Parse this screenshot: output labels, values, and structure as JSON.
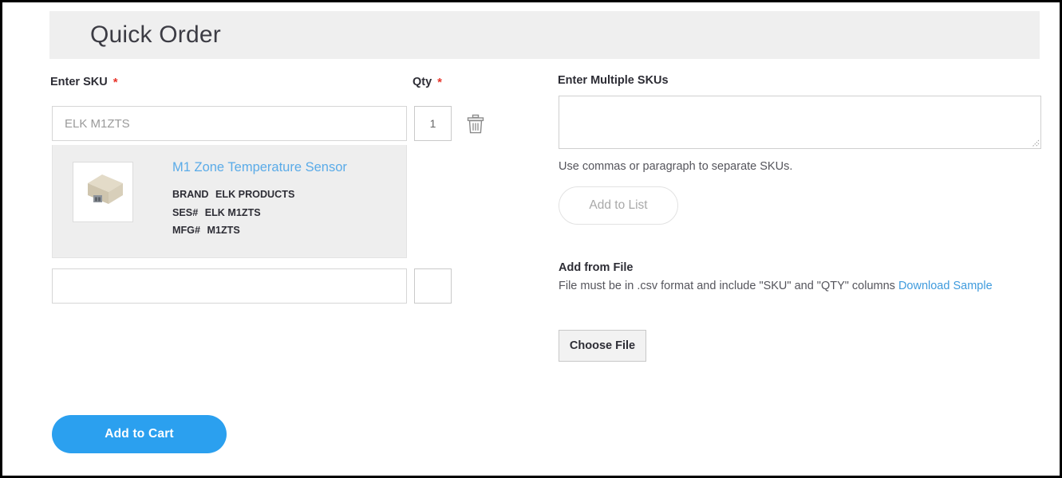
{
  "header": {
    "title": "Quick Order"
  },
  "left_panel": {
    "sku_label": "Enter SKU",
    "qty_label": "Qty",
    "required_marker": "*",
    "rows": [
      {
        "sku_value": "ELK M1ZTS",
        "qty_value": "1",
        "delete_icon": "trash-icon"
      },
      {
        "sku_value": "",
        "qty_value": ""
      }
    ],
    "product": {
      "title": "M1 Zone Temperature Sensor",
      "image_alt": "M1 Zone Temperature Sensor product photo",
      "meta": [
        {
          "key": "BRAND",
          "value": "ELK PRODUCTS"
        },
        {
          "key": "SES#",
          "value": "ELK M1ZTS"
        },
        {
          "key": "MFG#",
          "value": "M1ZTS"
        }
      ]
    },
    "add_to_cart_label": "Add to Cart"
  },
  "right_panel": {
    "multi_sku_label": "Enter Multiple SKUs",
    "multi_sku_value": "",
    "multi_sku_helper": "Use commas or paragraph to separate SKUs.",
    "add_to_list_label": "Add to List",
    "add_from_file_label": "Add from File",
    "file_help_text": "File must be in .csv format and include \"SKU\" and \"QTY\" columns ",
    "download_sample_label": "Download Sample",
    "choose_file_label": "Choose File"
  },
  "colors": {
    "accent_blue": "#2ba0ef",
    "link_blue": "#5aabe8",
    "required_red": "#e8352b",
    "header_gray": "#efefef",
    "card_gray": "#eeeeee"
  }
}
